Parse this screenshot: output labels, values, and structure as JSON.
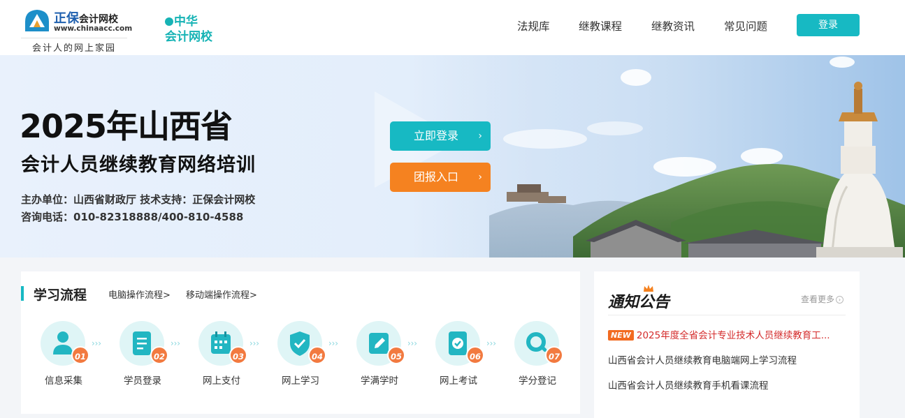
{
  "header": {
    "brand_name": "正保",
    "brand_name_b": "会计网校",
    "brand_url": "www.chinaacc.com",
    "brand_slogan": "会计人的网上家园",
    "partner_line1": "中华",
    "partner_line2": "会计网校",
    "nav": [
      "法规库",
      "继教课程",
      "继教资讯",
      "常见问题"
    ],
    "login_label": "登录"
  },
  "banner": {
    "title": "2025年山西省",
    "subtitle": "会计人员继续教育网络培训",
    "host": "主办单位：山西省财政厅   技术支持：正保会计网校",
    "phone": "咨询电话：010-82318888/400-810-4588",
    "login_button": "立即登录",
    "group_button": "团报入口",
    "arrow": "›",
    "colors": {
      "login": "#17b9c3",
      "group": "#f58220"
    }
  },
  "flow": {
    "title": "学习流程",
    "links": [
      "电脑操作流程>",
      "移动端操作流程>"
    ],
    "steps": [
      {
        "num": "01",
        "label": "信息采集",
        "icon": "user-icon"
      },
      {
        "num": "02",
        "label": "学员登录",
        "icon": "document-icon"
      },
      {
        "num": "03",
        "label": "网上支付",
        "icon": "calendar-icon"
      },
      {
        "num": "04",
        "label": "网上学习",
        "icon": "shield-check-icon"
      },
      {
        "num": "05",
        "label": "学满学时",
        "icon": "edit-icon"
      },
      {
        "num": "06",
        "label": "网上考试",
        "icon": "exam-icon"
      },
      {
        "num": "07",
        "label": "学分登记",
        "icon": "search-icon"
      }
    ],
    "chevrons": "› › ›"
  },
  "notice": {
    "title": "通知公告",
    "more": "查看更多",
    "more_icon": "›",
    "badge": "NEW",
    "items": [
      "2025年度全省会计专业技术人员继续教育工...",
      "山西省会计人员继续教育电脑端网上学习流程",
      "山西省会计人员继续教育手机看课流程"
    ]
  }
}
